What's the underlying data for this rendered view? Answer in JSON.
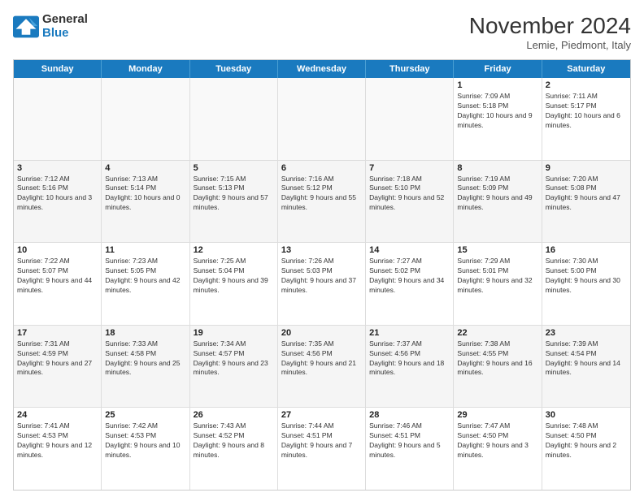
{
  "logo": {
    "line1": "General",
    "line2": "Blue"
  },
  "title": "November 2024",
  "location": "Lemie, Piedmont, Italy",
  "weekdays": [
    "Sunday",
    "Monday",
    "Tuesday",
    "Wednesday",
    "Thursday",
    "Friday",
    "Saturday"
  ],
  "rows": [
    [
      {
        "day": "",
        "text": ""
      },
      {
        "day": "",
        "text": ""
      },
      {
        "day": "",
        "text": ""
      },
      {
        "day": "",
        "text": ""
      },
      {
        "day": "",
        "text": ""
      },
      {
        "day": "1",
        "text": "Sunrise: 7:09 AM\nSunset: 5:18 PM\nDaylight: 10 hours and 9 minutes."
      },
      {
        "day": "2",
        "text": "Sunrise: 7:11 AM\nSunset: 5:17 PM\nDaylight: 10 hours and 6 minutes."
      }
    ],
    [
      {
        "day": "3",
        "text": "Sunrise: 7:12 AM\nSunset: 5:16 PM\nDaylight: 10 hours and 3 minutes."
      },
      {
        "day": "4",
        "text": "Sunrise: 7:13 AM\nSunset: 5:14 PM\nDaylight: 10 hours and 0 minutes."
      },
      {
        "day": "5",
        "text": "Sunrise: 7:15 AM\nSunset: 5:13 PM\nDaylight: 9 hours and 57 minutes."
      },
      {
        "day": "6",
        "text": "Sunrise: 7:16 AM\nSunset: 5:12 PM\nDaylight: 9 hours and 55 minutes."
      },
      {
        "day": "7",
        "text": "Sunrise: 7:18 AM\nSunset: 5:10 PM\nDaylight: 9 hours and 52 minutes."
      },
      {
        "day": "8",
        "text": "Sunrise: 7:19 AM\nSunset: 5:09 PM\nDaylight: 9 hours and 49 minutes."
      },
      {
        "day": "9",
        "text": "Sunrise: 7:20 AM\nSunset: 5:08 PM\nDaylight: 9 hours and 47 minutes."
      }
    ],
    [
      {
        "day": "10",
        "text": "Sunrise: 7:22 AM\nSunset: 5:07 PM\nDaylight: 9 hours and 44 minutes."
      },
      {
        "day": "11",
        "text": "Sunrise: 7:23 AM\nSunset: 5:05 PM\nDaylight: 9 hours and 42 minutes."
      },
      {
        "day": "12",
        "text": "Sunrise: 7:25 AM\nSunset: 5:04 PM\nDaylight: 9 hours and 39 minutes."
      },
      {
        "day": "13",
        "text": "Sunrise: 7:26 AM\nSunset: 5:03 PM\nDaylight: 9 hours and 37 minutes."
      },
      {
        "day": "14",
        "text": "Sunrise: 7:27 AM\nSunset: 5:02 PM\nDaylight: 9 hours and 34 minutes."
      },
      {
        "day": "15",
        "text": "Sunrise: 7:29 AM\nSunset: 5:01 PM\nDaylight: 9 hours and 32 minutes."
      },
      {
        "day": "16",
        "text": "Sunrise: 7:30 AM\nSunset: 5:00 PM\nDaylight: 9 hours and 30 minutes."
      }
    ],
    [
      {
        "day": "17",
        "text": "Sunrise: 7:31 AM\nSunset: 4:59 PM\nDaylight: 9 hours and 27 minutes."
      },
      {
        "day": "18",
        "text": "Sunrise: 7:33 AM\nSunset: 4:58 PM\nDaylight: 9 hours and 25 minutes."
      },
      {
        "day": "19",
        "text": "Sunrise: 7:34 AM\nSunset: 4:57 PM\nDaylight: 9 hours and 23 minutes."
      },
      {
        "day": "20",
        "text": "Sunrise: 7:35 AM\nSunset: 4:56 PM\nDaylight: 9 hours and 21 minutes."
      },
      {
        "day": "21",
        "text": "Sunrise: 7:37 AM\nSunset: 4:56 PM\nDaylight: 9 hours and 18 minutes."
      },
      {
        "day": "22",
        "text": "Sunrise: 7:38 AM\nSunset: 4:55 PM\nDaylight: 9 hours and 16 minutes."
      },
      {
        "day": "23",
        "text": "Sunrise: 7:39 AM\nSunset: 4:54 PM\nDaylight: 9 hours and 14 minutes."
      }
    ],
    [
      {
        "day": "24",
        "text": "Sunrise: 7:41 AM\nSunset: 4:53 PM\nDaylight: 9 hours and 12 minutes."
      },
      {
        "day": "25",
        "text": "Sunrise: 7:42 AM\nSunset: 4:53 PM\nDaylight: 9 hours and 10 minutes."
      },
      {
        "day": "26",
        "text": "Sunrise: 7:43 AM\nSunset: 4:52 PM\nDaylight: 9 hours and 8 minutes."
      },
      {
        "day": "27",
        "text": "Sunrise: 7:44 AM\nSunset: 4:51 PM\nDaylight: 9 hours and 7 minutes."
      },
      {
        "day": "28",
        "text": "Sunrise: 7:46 AM\nSunset: 4:51 PM\nDaylight: 9 hours and 5 minutes."
      },
      {
        "day": "29",
        "text": "Sunrise: 7:47 AM\nSunset: 4:50 PM\nDaylight: 9 hours and 3 minutes."
      },
      {
        "day": "30",
        "text": "Sunrise: 7:48 AM\nSunset: 4:50 PM\nDaylight: 9 hours and 2 minutes."
      }
    ]
  ]
}
